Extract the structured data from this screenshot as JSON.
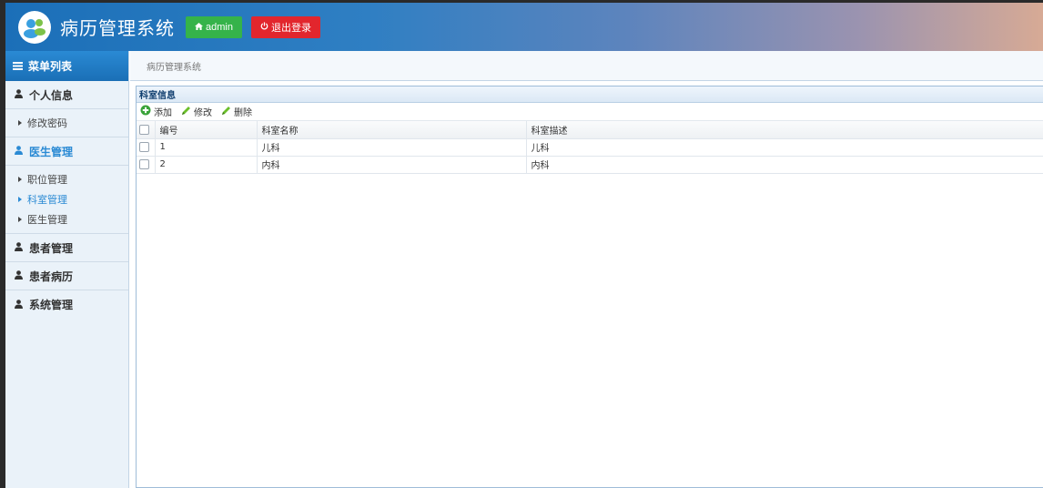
{
  "header": {
    "title": "病历管理系统",
    "user_label": "admin",
    "logout_label": "退出登录"
  },
  "sidebar": {
    "menu_title": "菜单列表",
    "groups": [
      {
        "label": "个人信息",
        "items": [
          "修改密码"
        ]
      },
      {
        "label": "医生管理",
        "items": [
          "职位管理",
          "科室管理",
          "医生管理"
        ]
      },
      {
        "label": "患者管理"
      },
      {
        "label": "患者病历"
      },
      {
        "label": "系统管理"
      }
    ],
    "active_group": "医生管理",
    "active_item": "科室管理"
  },
  "tab": {
    "label": "病历管理系统"
  },
  "panel": {
    "title": "科室信息",
    "toolbar": {
      "add": "添加",
      "edit": "修改",
      "delete": "删除"
    },
    "columns": [
      "编号",
      "科室名称",
      "科室描述"
    ],
    "rows": [
      {
        "id": "1",
        "name": "儿科",
        "desc": "儿科"
      },
      {
        "id": "2",
        "name": "内科",
        "desc": "内科"
      }
    ]
  },
  "colors": {
    "accent": "#2a8ad4",
    "admin_btn": "#35b34a",
    "logout_btn": "#e2262d"
  }
}
